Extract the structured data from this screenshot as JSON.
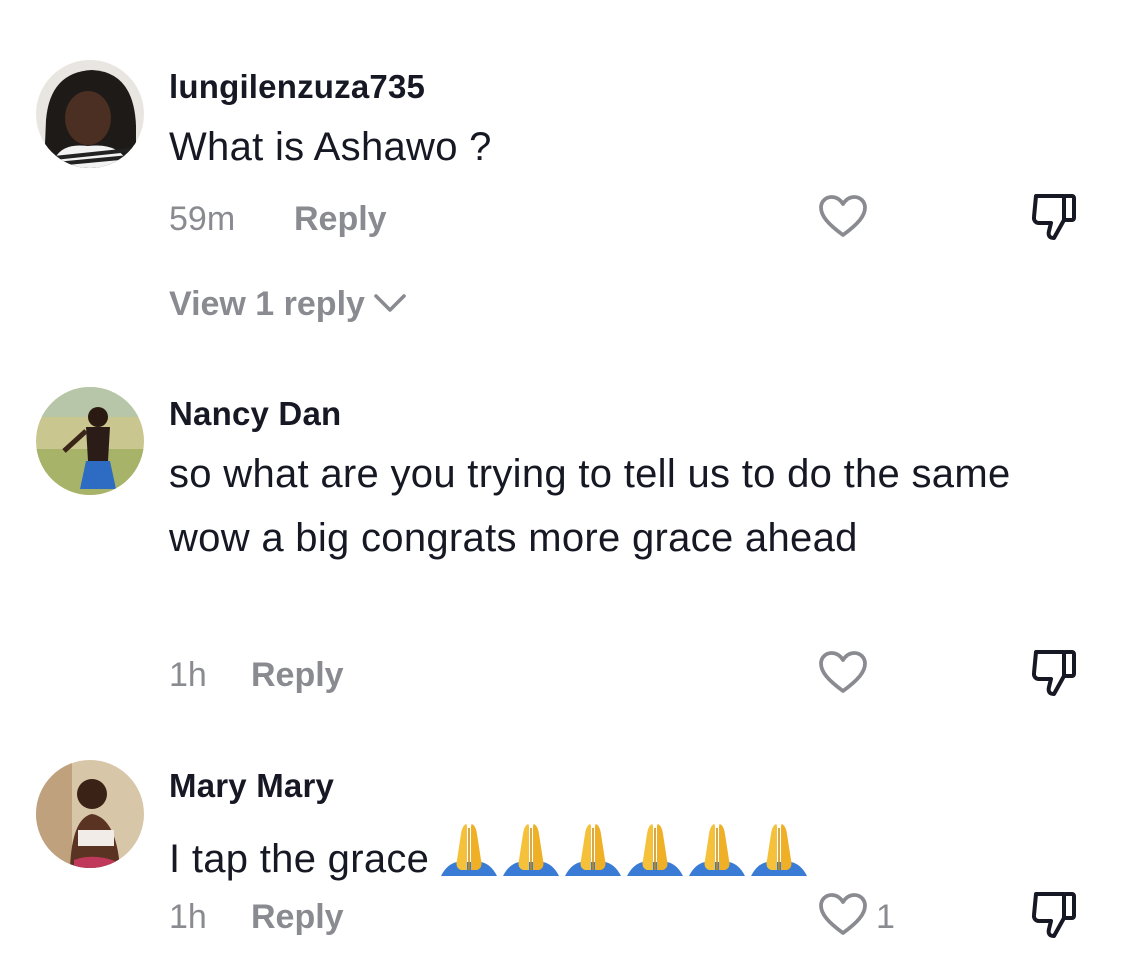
{
  "comments": [
    {
      "username": "lungilenzuza735",
      "text": "What is Ashawo ?",
      "time": "59m",
      "reply_label": "Reply",
      "like_count": "",
      "view_replies": "View 1 reply",
      "avatar_icon": "avatar-photo"
    },
    {
      "username": "Nancy Dan",
      "text": "so what are you trying to tell us to do the same wow a big congrats more grace ahead",
      "time": "1h",
      "reply_label": "Reply",
      "like_count": "",
      "avatar_icon": "avatar-photo"
    },
    {
      "username": "Mary Mary",
      "text": "I tap the grace",
      "emoji": "🙏🙏🙏🙏🙏🙏",
      "emoji_icon": "praying-hands-emoji",
      "time": "1h",
      "reply_label": "Reply",
      "like_count": "1",
      "avatar_icon": "avatar-photo"
    }
  ],
  "icons": {
    "like": "heart-outline-icon",
    "dislike": "thumbs-down-icon",
    "expand": "chevron-down-icon"
  },
  "colors": {
    "text": "#161823",
    "muted": "#8a8b91",
    "background": "#ffffff"
  }
}
